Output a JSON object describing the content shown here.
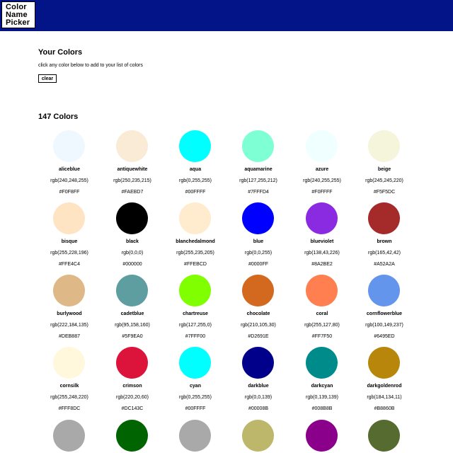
{
  "header": {
    "logo_lines": [
      "Color",
      "Name",
      "Picker"
    ]
  },
  "your_colors": {
    "title": "Your Colors",
    "hint": "click any color below to add to your list of colors",
    "clear_label": "clear"
  },
  "all_colors": {
    "title": "147 Colors"
  },
  "colors": [
    {
      "name": "aliceblue",
      "rgb": "rgb(240,248,255)",
      "hex": "#F0F8FF"
    },
    {
      "name": "antiquewhite",
      "rgb": "rgb(250,235,215)",
      "hex": "#FAEBD7"
    },
    {
      "name": "aqua",
      "rgb": "rgb(0,255,255)",
      "hex": "#00FFFF"
    },
    {
      "name": "aquamarine",
      "rgb": "rgb(127,255,212)",
      "hex": "#7FFFD4"
    },
    {
      "name": "azure",
      "rgb": "rgb(240,255,255)",
      "hex": "#F0FFFF"
    },
    {
      "name": "beige",
      "rgb": "rgb(245,245,220)",
      "hex": "#F5F5DC"
    },
    {
      "name": "bisque",
      "rgb": "rgb(255,228,196)",
      "hex": "#FFE4C4"
    },
    {
      "name": "black",
      "rgb": "rgb(0,0,0)",
      "hex": "#000000"
    },
    {
      "name": "blanchedalmond",
      "rgb": "rgb(255,235,205)",
      "hex": "#FFEBCD"
    },
    {
      "name": "blue",
      "rgb": "rgb(0,0,255)",
      "hex": "#0000FF"
    },
    {
      "name": "blueviolet",
      "rgb": "rgb(138,43,226)",
      "hex": "#8A2BE2"
    },
    {
      "name": "brown",
      "rgb": "rgb(165,42,42)",
      "hex": "#A52A2A"
    },
    {
      "name": "burlywood",
      "rgb": "rgb(222,184,135)",
      "hex": "#DEB887"
    },
    {
      "name": "cadetblue",
      "rgb": "rgb(95,158,160)",
      "hex": "#5F9EA0"
    },
    {
      "name": "chartreuse",
      "rgb": "rgb(127,255,0)",
      "hex": "#7FFF00"
    },
    {
      "name": "chocolate",
      "rgb": "rgb(210,105,30)",
      "hex": "#D2691E"
    },
    {
      "name": "coral",
      "rgb": "rgb(255,127,80)",
      "hex": "#FF7F50"
    },
    {
      "name": "cornflowerblue",
      "rgb": "rgb(100,149,237)",
      "hex": "#6495ED"
    },
    {
      "name": "cornsilk",
      "rgb": "rgb(255,248,220)",
      "hex": "#FFF8DC"
    },
    {
      "name": "crimson",
      "rgb": "rgb(220,20,60)",
      "hex": "#DC143C"
    },
    {
      "name": "cyan",
      "rgb": "rgb(0,255,255)",
      "hex": "#00FFFF"
    },
    {
      "name": "darkblue",
      "rgb": "rgb(0,0,139)",
      "hex": "#00008B"
    },
    {
      "name": "darkcyan",
      "rgb": "rgb(0,139,139)",
      "hex": "#008B8B"
    },
    {
      "name": "darkgoldenrod",
      "rgb": "rgb(184,134,11)",
      "hex": "#B8860B"
    }
  ],
  "partial_row_colors": [
    "#A9A9A9",
    "#006400",
    "#A9A9A9",
    "#BDB76B",
    "#8B008B",
    "#556B2F"
  ]
}
